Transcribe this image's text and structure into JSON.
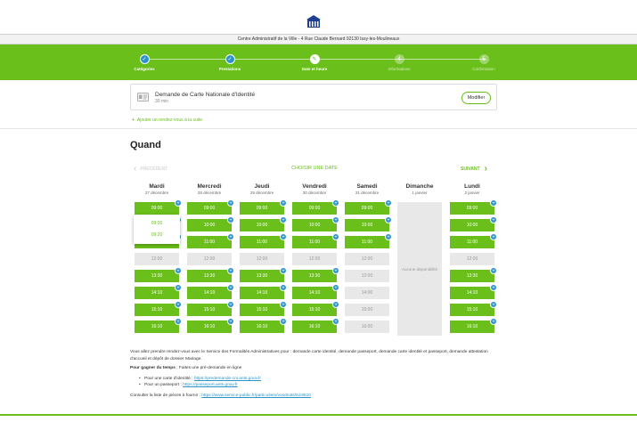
{
  "header": {
    "address": "Centre Administratif de la Ville - 4 Rue Claude Bernard 92130 Issy-les-Moulineaux"
  },
  "steps": [
    {
      "label": "Catégories",
      "state": "done"
    },
    {
      "label": "Prestations",
      "state": "done"
    },
    {
      "label": "Date et heure",
      "state": "current"
    },
    {
      "label": "Informations",
      "state": "todo",
      "number": "4"
    },
    {
      "label": "Confirmation",
      "state": "todo",
      "number": "5"
    }
  ],
  "service": {
    "name": "Demande de Carte Nationale d'Identité",
    "duration": "30 min",
    "modify_label": "Modifier"
  },
  "add_rdv": "Ajouter un rendez-vous à la suite",
  "quand": "Quand",
  "nav": {
    "prev": "PRÉCÉDENT",
    "choose": "CHOISIR UNE DATE",
    "next": "SUIVANT"
  },
  "days": [
    {
      "name": "Mardi",
      "date": "27 décembre",
      "slots": [
        {
          "time": "09:00",
          "available": true
        },
        {
          "time": "09:30",
          "available": true
        },
        {
          "time": "11:00",
          "available": true
        },
        {
          "time": "12:00",
          "available": false
        },
        {
          "time": "13:30",
          "available": true
        },
        {
          "time": "14:10",
          "available": true
        },
        {
          "time": "15:10",
          "available": true
        },
        {
          "time": "16:10",
          "available": true
        }
      ]
    },
    {
      "name": "Mercredi",
      "date": "28 décembre",
      "slots": [
        {
          "time": "09:00",
          "available": true
        },
        {
          "time": "10:00",
          "available": true
        },
        {
          "time": "11:00",
          "available": true
        },
        {
          "time": "12:00",
          "available": false
        },
        {
          "time": "13:30",
          "available": true
        },
        {
          "time": "14:10",
          "available": true
        },
        {
          "time": "15:10",
          "available": true
        },
        {
          "time": "16:10",
          "available": true
        }
      ]
    },
    {
      "name": "Jeudi",
      "date": "29 décembre",
      "slots": [
        {
          "time": "09:00",
          "available": true
        },
        {
          "time": "10:00",
          "available": true
        },
        {
          "time": "11:00",
          "available": true
        },
        {
          "time": "12:00",
          "available": false
        },
        {
          "time": "13:30",
          "available": true
        },
        {
          "time": "14:10",
          "available": true
        },
        {
          "time": "15:10",
          "available": true
        },
        {
          "time": "16:10",
          "available": true
        }
      ]
    },
    {
      "name": "Vendredi",
      "date": "30 décembre",
      "slots": [
        {
          "time": "09:00",
          "available": true
        },
        {
          "time": "10:00",
          "available": true
        },
        {
          "time": "11:00",
          "available": true
        },
        {
          "time": "12:00",
          "available": false
        },
        {
          "time": "13:30",
          "available": true
        },
        {
          "time": "14:10",
          "available": true
        },
        {
          "time": "15:10",
          "available": true
        },
        {
          "time": "16:10",
          "available": true
        }
      ]
    },
    {
      "name": "Samedi",
      "date": "31 décembre",
      "slots": [
        {
          "time": "09:00",
          "available": true
        },
        {
          "time": "10:00",
          "available": true
        },
        {
          "time": "11:00",
          "available": true
        },
        {
          "time": "12:00",
          "available": false
        },
        {
          "time": "12:00",
          "available": false
        },
        {
          "time": "14:00",
          "available": false
        },
        {
          "time": "15:00",
          "available": false
        },
        {
          "time": "16:00",
          "available": false
        }
      ]
    },
    {
      "name": "Dimanche",
      "date": "1 janvier",
      "slots": [],
      "empty_label": "Aucune disponibilité"
    },
    {
      "name": "Lundi",
      "date": "2 janvier",
      "slots": [
        {
          "time": "09:00",
          "available": true
        },
        {
          "time": "10:00",
          "available": true
        },
        {
          "time": "11:00",
          "available": true
        },
        {
          "time": "12:00",
          "available": false
        },
        {
          "time": "13:30",
          "available": true
        },
        {
          "time": "14:10",
          "available": true
        },
        {
          "time": "15:10",
          "available": true
        },
        {
          "time": "16:10",
          "available": true
        }
      ]
    }
  ],
  "popup": {
    "options": [
      "09:00",
      "09:20"
    ]
  },
  "info": {
    "para1": "Vous allez prendre rendez-vous avec le Service des Formalités Administratives pour : demande carte identité, demande passeport, demande carte identité et passeport, demande attestation d'accueil et dépôt de dossier Mariage.",
    "gain_bold": "Pour gagner du temps",
    "gain_rest": " : Faites une pré-demande en ligne",
    "cni_label": "Pour une carte d'identité : ",
    "cni_link": "https://predemande-cni.ants.gouv.fr",
    "pass_label": "Pour un passeport : ",
    "pass_link": "https://passeport.ants.gouv.fr",
    "pieces_label": "Consulter la liste de pièces à fournir : ",
    "pieces_link": "https://www.service-public.fr/particuliers/vosdroits/N19810"
  },
  "colors": {
    "brand_green": "#6abf1a",
    "accent_blue": "#2a93c9",
    "unavailable_gray": "#e8e8e8"
  }
}
